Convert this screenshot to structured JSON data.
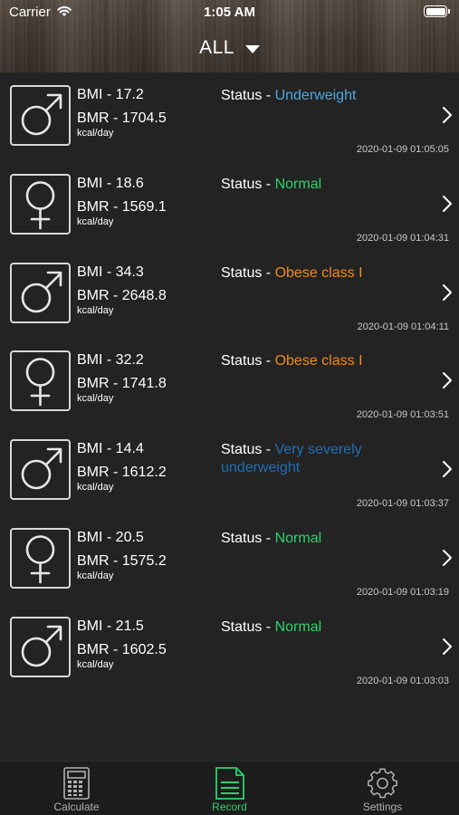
{
  "status_bar": {
    "carrier": "Carrier",
    "time": "1:05 AM"
  },
  "header": {
    "filter_label": "ALL"
  },
  "colors": {
    "underweight": "#4aa8e0",
    "normal": "#2fd16c",
    "obese": "#f08a1d",
    "very_severely_underweight": "#1f6fb8",
    "tab_active": "#2fd16c",
    "tab_inactive": "#b0b0b0"
  },
  "records": [
    {
      "gender": "male",
      "bmi": "BMI - 17.2",
      "bmr": "BMR - 1704.5",
      "unit": "kcal/day",
      "status_prefix": "Status - ",
      "status": "Underweight",
      "status_color": "#4aa8e0",
      "timestamp": "2020-01-09 01:05:05"
    },
    {
      "gender": "female",
      "bmi": "BMI - 18.6",
      "bmr": "BMR - 1569.1",
      "unit": "kcal/day",
      "status_prefix": "Status - ",
      "status": "Normal",
      "status_color": "#2fd16c",
      "timestamp": "2020-01-09 01:04:31"
    },
    {
      "gender": "male",
      "bmi": "BMI - 34.3",
      "bmr": "BMR - 2648.8",
      "unit": "kcal/day",
      "status_prefix": "Status - ",
      "status": "Obese class I",
      "status_color": "#f08a1d",
      "timestamp": "2020-01-09 01:04:11"
    },
    {
      "gender": "female",
      "bmi": "BMI - 32.2",
      "bmr": "BMR - 1741.8",
      "unit": "kcal/day",
      "status_prefix": "Status - ",
      "status": "Obese class I",
      "status_color": "#f08a1d",
      "timestamp": "2020-01-09 01:03:51"
    },
    {
      "gender": "male",
      "bmi": "BMI - 14.4",
      "bmr": "BMR - 1612.2",
      "unit": "kcal/day",
      "status_prefix": "Status - ",
      "status": "Very severely underweight",
      "status_color": "#1f6fb8",
      "timestamp": "2020-01-09 01:03:37"
    },
    {
      "gender": "female",
      "bmi": "BMI - 20.5",
      "bmr": "BMR - 1575.2",
      "unit": "kcal/day",
      "status_prefix": "Status - ",
      "status": "Normal",
      "status_color": "#2fd16c",
      "timestamp": "2020-01-09 01:03:19"
    },
    {
      "gender": "male",
      "bmi": "BMI - 21.5",
      "bmr": "BMR - 1602.5",
      "unit": "kcal/day",
      "status_prefix": "Status - ",
      "status": "Normal",
      "status_color": "#2fd16c",
      "timestamp": "2020-01-09 01:03:03"
    }
  ],
  "tabs": [
    {
      "label": "Calculate",
      "icon": "calculator-icon",
      "active": false
    },
    {
      "label": "Record",
      "icon": "document-icon",
      "active": true
    },
    {
      "label": "Settings",
      "icon": "gear-icon",
      "active": false
    }
  ]
}
